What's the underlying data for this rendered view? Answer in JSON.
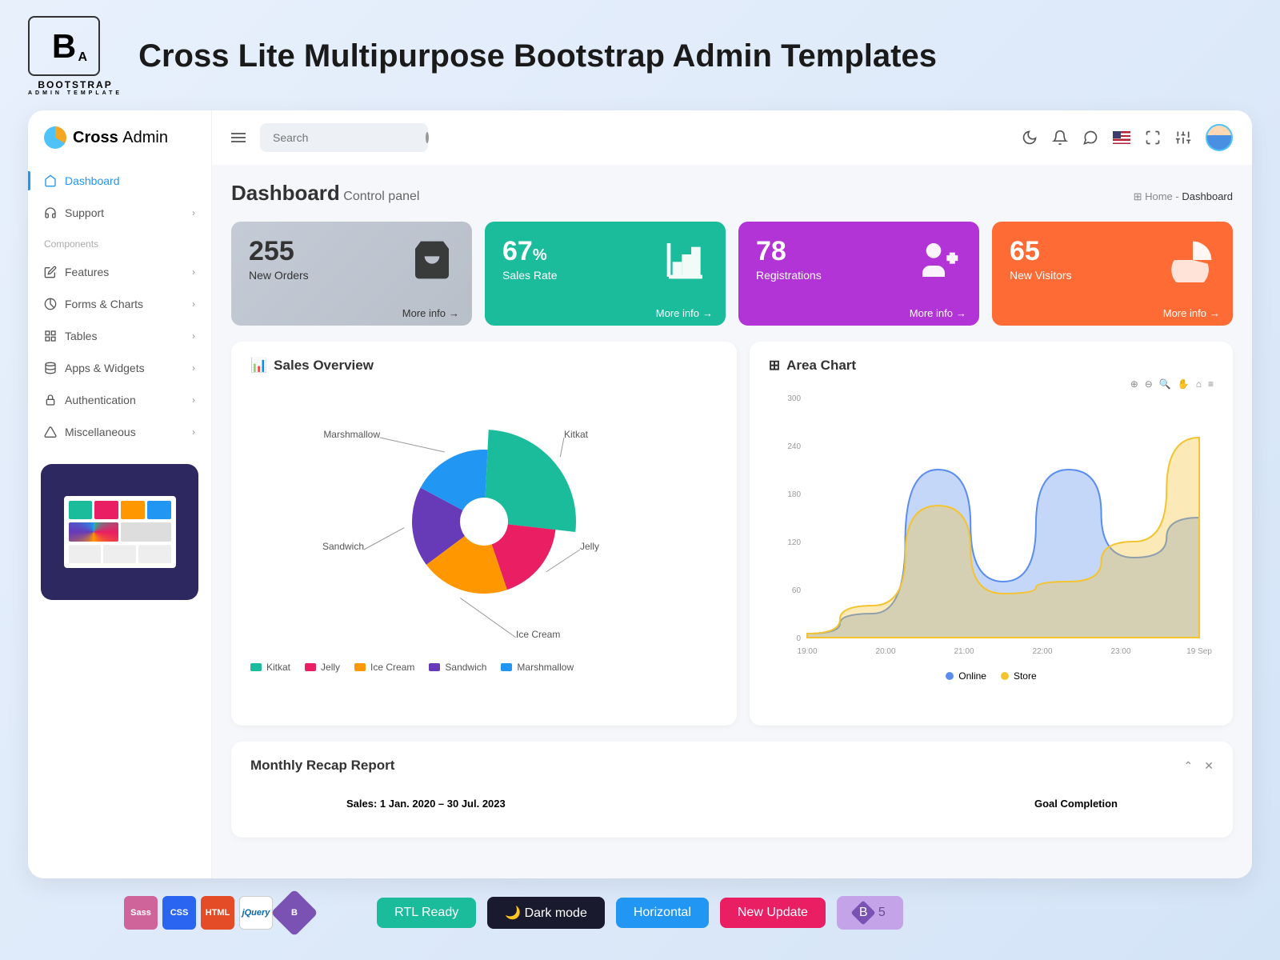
{
  "brand": {
    "logo_text": "B",
    "logo_sub": "A",
    "subtitle": "BOOTSTRAP",
    "subtitle2": "ADMIN TEMPLATE"
  },
  "main_title": "Cross Lite Multipurpose Bootstrap Admin Templates",
  "app_brand": {
    "name": "Cross",
    "suffix": "Admin"
  },
  "search": {
    "placeholder": "Search"
  },
  "nav": {
    "items": [
      {
        "label": "Dashboard",
        "has_chev": false
      },
      {
        "label": "Support",
        "has_chev": true
      }
    ],
    "section": "Components",
    "items2": [
      {
        "label": "Features"
      },
      {
        "label": "Forms & Charts"
      },
      {
        "label": "Tables"
      },
      {
        "label": "Apps & Widgets"
      },
      {
        "label": "Authentication"
      },
      {
        "label": "Miscellaneous"
      }
    ]
  },
  "page": {
    "title": "Dashboard",
    "subtitle": "Control panel"
  },
  "breadcrumb": {
    "home": "Home",
    "sep": "-",
    "current": "Dashboard"
  },
  "stats": [
    {
      "value": "255",
      "unit": "",
      "label": "New Orders",
      "more": "More info"
    },
    {
      "value": "67",
      "unit": "%",
      "label": "Sales Rate",
      "more": "More info"
    },
    {
      "value": "78",
      "unit": "",
      "label": "Registrations",
      "more": "More info"
    },
    {
      "value": "65",
      "unit": "",
      "label": "New Visitors",
      "more": "More info"
    }
  ],
  "sales_card": {
    "title": "Sales Overview",
    "legend": [
      "Kitkat",
      "Jelly",
      "Ice Cream",
      "Sandwich",
      "Marshmallow"
    ]
  },
  "area_card": {
    "title": "Area Chart",
    "legend": {
      "online": "Online",
      "store": "Store"
    },
    "xticks": [
      "19:00",
      "20:00",
      "21:00",
      "22:00",
      "23:00",
      "19 Sep"
    ],
    "yticks": [
      "0",
      "60",
      "120",
      "180",
      "240",
      "300"
    ]
  },
  "recap": {
    "title": "Monthly Recap Report",
    "left": "Sales: 1 Jan. 2020 – 30 Jul. 2023",
    "right": "Goal Completion"
  },
  "footer_pills": {
    "rtl": "RTL Ready",
    "dark": "Dark mode",
    "horizontal": "Horizontal",
    "update": "New Update",
    "version": "5"
  },
  "chart_data": [
    {
      "type": "pie",
      "title": "Sales Overview",
      "series": [
        {
          "name": "Kitkat",
          "value": 26,
          "color": "#1abc9c"
        },
        {
          "name": "Jelly",
          "value": 18,
          "color": "#e91e63"
        },
        {
          "name": "Ice Cream",
          "value": 20,
          "color": "#ff9800"
        },
        {
          "name": "Sandwich",
          "value": 18,
          "color": "#673ab7"
        },
        {
          "name": "Marshmallow",
          "value": 18,
          "color": "#2196f3"
        }
      ]
    },
    {
      "type": "area",
      "title": "Area Chart",
      "xlabel": "",
      "ylabel": "",
      "ylim": [
        0,
        300
      ],
      "categories": [
        "19:00",
        "20:00",
        "21:00",
        "22:00",
        "23:00",
        "19 Sep"
      ],
      "series": [
        {
          "name": "Online",
          "color": "#5a8dee",
          "values": [
            5,
            30,
            210,
            70,
            210,
            100,
            150
          ]
        },
        {
          "name": "Store",
          "color": "#f4c430",
          "values": [
            5,
            40,
            165,
            55,
            70,
            120,
            250
          ]
        }
      ]
    }
  ]
}
